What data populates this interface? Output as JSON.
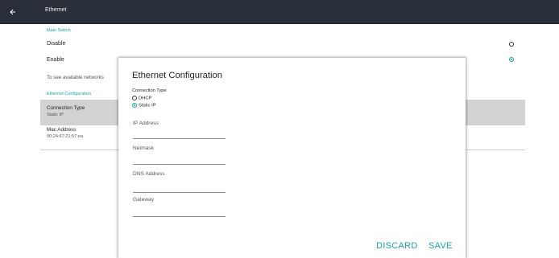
{
  "header": {
    "back_icon": "arrow-left-icon",
    "title": "Ethernet"
  },
  "main_switch": {
    "section_label": "Main Switch",
    "disable_label": "Disable",
    "enable_label": "Enable",
    "selected": "Enable",
    "hint": "To see available networks"
  },
  "ethernet_config": {
    "section_label": "Ethernet Configuration",
    "connection_type_title": "Connection Type",
    "connection_type_value": "Static IP",
    "mac_title": "Mac Address",
    "mac_value": "00:24:67:21:57:ea"
  },
  "dialog": {
    "title": "Ethernet Configuration",
    "connection_type_label": "Connection Type",
    "options": [
      "DHCP",
      "Static IP"
    ],
    "selected_option": "Static IP",
    "fields": {
      "ip_address": {
        "label": "IP Address",
        "value": ""
      },
      "netmask": {
        "label": "Netmask",
        "value": ""
      },
      "dns_address": {
        "label": "DNS Address",
        "value": ""
      },
      "gateway": {
        "label": "Gateway",
        "value": ""
      }
    },
    "discard_label": "DISCARD",
    "save_label": "SAVE"
  },
  "colors": {
    "accent": "#1aa39a",
    "topbar": "#2a3039",
    "highlight": "#d3d3d3"
  }
}
